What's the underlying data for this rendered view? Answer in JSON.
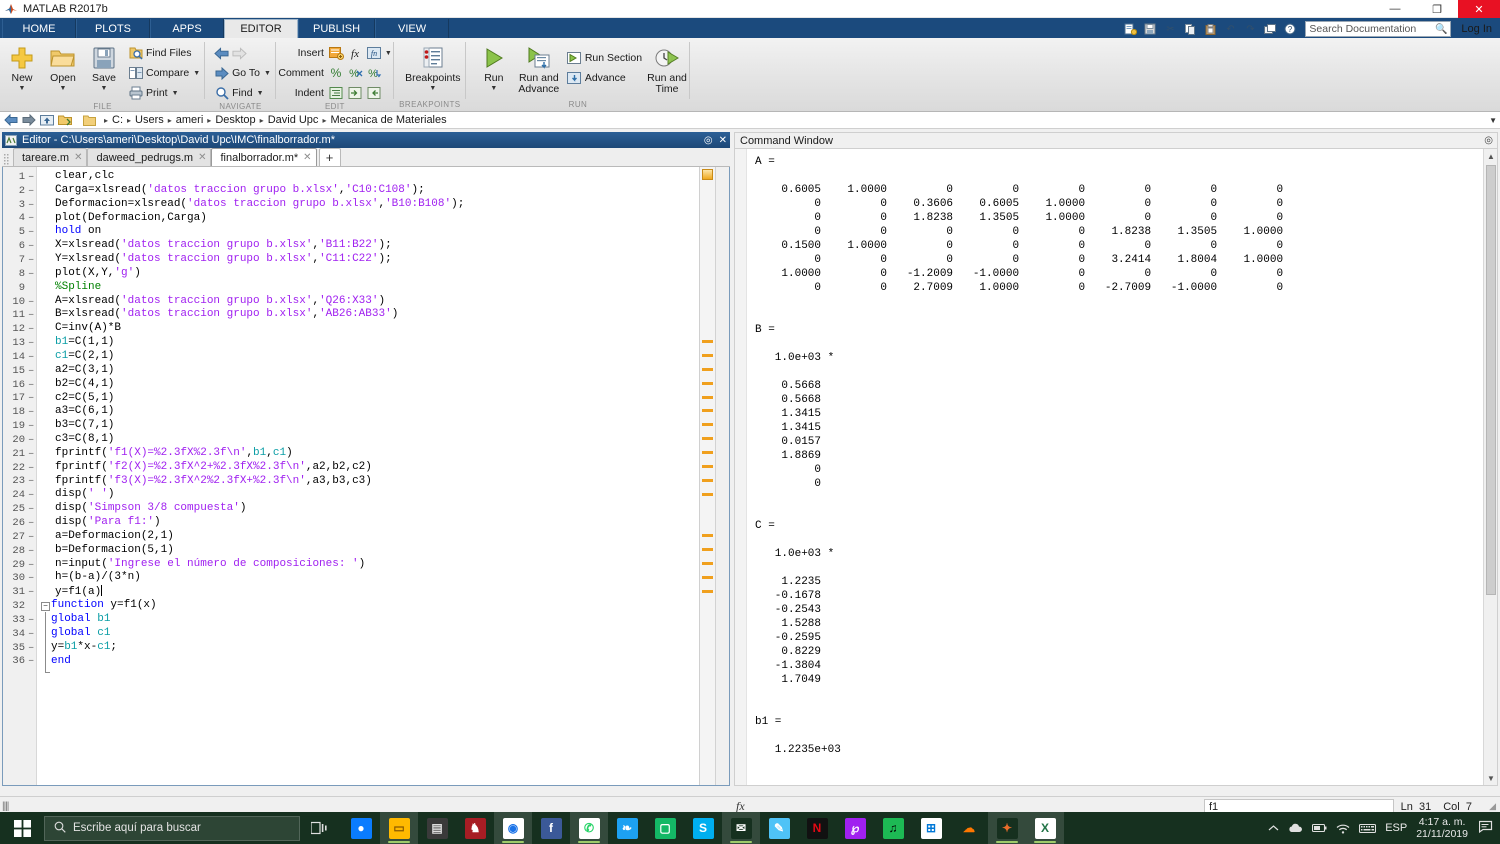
{
  "window": {
    "title": "MATLAB R2017b",
    "minimize": "—",
    "maximize": "❐",
    "close": "✕"
  },
  "ribbon": {
    "tabs": [
      {
        "label": "HOME",
        "active": false
      },
      {
        "label": "PLOTS",
        "active": false
      },
      {
        "label": "APPS",
        "active": false
      },
      {
        "label": "EDITOR",
        "active": true
      },
      {
        "label": "PUBLISH",
        "active": false
      },
      {
        "label": "VIEW",
        "active": false
      }
    ],
    "quick_access": [
      "new-script-icon",
      "save-icon",
      "cut-icon",
      "copy-icon",
      "paste-icon",
      "undo-icon",
      "redo-icon",
      "switch-window-icon",
      "help-icon"
    ],
    "search_placeholder": "Search Documentation",
    "login_label": "Log In",
    "groups": [
      {
        "name": "FILE",
        "label": "FILE",
        "big_buttons": [
          {
            "label": "New",
            "icon": "new-file-icon",
            "has_caret": true
          },
          {
            "label": "Open",
            "icon": "open-folder-icon",
            "has_caret": true
          },
          {
            "label": "Save",
            "icon": "save-disk-icon",
            "has_caret": true
          }
        ],
        "small_buttons": [
          {
            "label": "Find Files",
            "icon": "find-files-icon",
            "has_caret": false
          },
          {
            "label": "Compare",
            "icon": "compare-icon",
            "has_caret": true
          },
          {
            "label": "Print",
            "icon": "print-icon",
            "has_caret": true
          }
        ]
      },
      {
        "name": "NAVIGATE",
        "label": "NAVIGATE",
        "small_buttons": [
          {
            "label": "",
            "icon": "back-arrow-icon",
            "has_caret": false
          },
          {
            "label": "Go To",
            "icon": "go-to-icon",
            "has_caret": true
          },
          {
            "label": "Find",
            "icon": "find-icon",
            "has_caret": true
          }
        ]
      },
      {
        "name": "EDIT",
        "label": "EDIT",
        "rows": [
          {
            "label": "Insert",
            "icons": [
              "insert-block-icon",
              "insert-function-icon",
              "insert-fx-icon"
            ],
            "has_caret": true
          },
          {
            "label": "Comment",
            "icons": [
              "comment-icon",
              "uncomment-icon",
              "wrap-comment-icon"
            ],
            "has_caret": false
          },
          {
            "label": "Indent",
            "icons": [
              "smart-indent-icon",
              "indent-right-icon",
              "indent-left-icon"
            ],
            "has_caret": false
          }
        ]
      },
      {
        "name": "BREAKPOINTS",
        "label": "BREAKPOINTS",
        "big_buttons": [
          {
            "label": "Breakpoints",
            "icon": "breakpoints-icon",
            "has_caret": true
          }
        ]
      },
      {
        "name": "RUN",
        "label": "RUN",
        "big_buttons": [
          {
            "label": "Run",
            "icon": "run-icon",
            "has_caret": true
          },
          {
            "label": "Run and Advance",
            "icon": "run-advance-icon",
            "has_caret": false
          },
          {
            "label": "Run and Time",
            "icon": "run-time-icon",
            "has_caret": false
          }
        ],
        "small_buttons": [
          {
            "label": "Run Section",
            "icon": "run-section-icon",
            "has_caret": false
          },
          {
            "label": "Advance",
            "icon": "advance-icon",
            "has_caret": false
          }
        ]
      }
    ]
  },
  "address_bar": {
    "crumbs": [
      "C:",
      "Users",
      "ameri",
      "Desktop",
      "David Upc",
      "Mecanica de Materiales"
    ],
    "separator": "▸"
  },
  "editor": {
    "title": "Editor - C:\\Users\\ameri\\Desktop\\David Upc\\IMC\\finalborrador.m*",
    "tabs": [
      {
        "label": "tareare.m",
        "active": false
      },
      {
        "label": "daweed_pedrugs.m",
        "active": false
      },
      {
        "label": "finalborrador.m*",
        "active": true
      }
    ],
    "new_tab_label": "+",
    "lines": [
      {
        "n": 1,
        "exec": true,
        "text": "clear,clc"
      },
      {
        "n": 2,
        "exec": true,
        "text": "Carga=xlsread('datos traccion grupo b.xlsx','C10:C108');"
      },
      {
        "n": 3,
        "exec": true,
        "text": "Deformacion=xlsread('datos traccion grupo b.xlsx','B10:B108');"
      },
      {
        "n": 4,
        "exec": true,
        "text": "plot(Deformacion,Carga)"
      },
      {
        "n": 5,
        "exec": true,
        "text": "hold on"
      },
      {
        "n": 6,
        "exec": true,
        "text": "X=xlsread('datos traccion grupo b.xlsx','B11:B22');"
      },
      {
        "n": 7,
        "exec": true,
        "text": "Y=xlsread('datos traccion grupo b.xlsx','C11:C22');"
      },
      {
        "n": 8,
        "exec": true,
        "text": "plot(X,Y,'g')"
      },
      {
        "n": 9,
        "exec": false,
        "text": "%Spline"
      },
      {
        "n": 10,
        "exec": true,
        "text": "A=xlsread('datos traccion grupo b.xlsx','Q26:X33')"
      },
      {
        "n": 11,
        "exec": true,
        "text": "B=xlsread('datos traccion grupo b.xlsx','AB26:AB33')"
      },
      {
        "n": 12,
        "exec": true,
        "text": "C=inv(A)*B"
      },
      {
        "n": 13,
        "exec": true,
        "text": "b1=C(1,1)"
      },
      {
        "n": 14,
        "exec": true,
        "text": "c1=C(2,1)"
      },
      {
        "n": 15,
        "exec": true,
        "text": "a2=C(3,1)"
      },
      {
        "n": 16,
        "exec": true,
        "text": "b2=C(4,1)"
      },
      {
        "n": 17,
        "exec": true,
        "text": "c2=C(5,1)"
      },
      {
        "n": 18,
        "exec": true,
        "text": "a3=C(6,1)"
      },
      {
        "n": 19,
        "exec": true,
        "text": "b3=C(7,1)"
      },
      {
        "n": 20,
        "exec": true,
        "text": "c3=C(8,1)"
      },
      {
        "n": 21,
        "exec": true,
        "text": "fprintf('f1(X)=%2.3fX%2.3f\\n',b1,c1)"
      },
      {
        "n": 22,
        "exec": true,
        "text": "fprintf('f2(X)=%2.3fX^2+%2.3fX%2.3f\\n',a2,b2,c2)"
      },
      {
        "n": 23,
        "exec": true,
        "text": "fprintf('f3(X)=%2.3fX^2%2.3fX+%2.3f\\n',a3,b3,c3)"
      },
      {
        "n": 24,
        "exec": true,
        "text": "disp(' ')"
      },
      {
        "n": 25,
        "exec": true,
        "text": "disp('Simpson 3/8 compuesta')"
      },
      {
        "n": 26,
        "exec": true,
        "text": "disp('Para f1:')"
      },
      {
        "n": 27,
        "exec": true,
        "text": "a=Deformacion(2,1)"
      },
      {
        "n": 28,
        "exec": true,
        "text": "b=Deformacion(5,1)"
      },
      {
        "n": 29,
        "exec": true,
        "text": "n=input('Ingrese el número de composiciones: ')"
      },
      {
        "n": 30,
        "exec": true,
        "text": "h=(b-a)/(3*n)"
      },
      {
        "n": 31,
        "exec": true,
        "text": "y=f1(a)"
      },
      {
        "n": 32,
        "exec": false,
        "text": "function y=f1(x)"
      },
      {
        "n": 33,
        "exec": true,
        "text": "global b1"
      },
      {
        "n": 34,
        "exec": true,
        "text": "global c1"
      },
      {
        "n": 35,
        "exec": true,
        "text": "y=b1*x-c1;"
      },
      {
        "n": 36,
        "exec": true,
        "text": "end"
      }
    ]
  },
  "command_window": {
    "title": "Command Window",
    "output": "A =\n\n    0.6005    1.0000         0         0         0         0         0         0\n         0         0    0.3606    0.6005    1.0000         0         0         0\n         0         0    1.8238    1.3505    1.0000         0         0         0\n         0         0         0         0         0    1.8238    1.3505    1.0000\n    0.1500    1.0000         0         0         0         0         0         0\n         0         0         0         0         0    3.2414    1.8004    1.0000\n    1.0000         0   -1.2009   -1.0000         0         0         0         0\n         0         0    2.7009    1.0000         0   -2.7009   -1.0000         0\n\n\nB =\n\n   1.0e+03 *\n\n    0.5668\n    0.5668\n    1.3415\n    1.3415\n    0.0157\n    1.8869\n         0\n         0\n\n\nC =\n\n   1.0e+03 *\n\n    1.2235\n   -0.1678\n   -0.2543\n    1.5288\n   -0.2595\n    0.8229\n   -1.3804\n    1.7049\n\n\nb1 =\n\n   1.2235e+03\n",
    "prompt_symbol": "fx"
  },
  "status_bar": {
    "function_name": "f1",
    "line_label": "Ln",
    "line_value": "31",
    "col_label": "Col",
    "col_value": "7"
  },
  "taskbar": {
    "search_placeholder": "Escribe aquí para buscar",
    "apps": [
      {
        "name": "messenger",
        "glyph": "●",
        "bg": "#0a7cff",
        "fg": "#ffffff",
        "active": false
      },
      {
        "name": "file-explorer",
        "glyph": "▭",
        "bg": "#ffb900",
        "fg": "#8a5a00",
        "active": true
      },
      {
        "name": "dark-app",
        "glyph": "▤",
        "bg": "#3a3a3a",
        "fg": "#dddddd",
        "active": false
      },
      {
        "name": "red-app",
        "glyph": "♞",
        "bg": "#a71d24",
        "fg": "#ffffff",
        "active": false
      },
      {
        "name": "google-chrome",
        "glyph": "◉",
        "bg": "#ffffff",
        "fg": "#1a73e8",
        "active": true
      },
      {
        "name": "facebook",
        "glyph": "f",
        "bg": "#3b5998",
        "fg": "#ffffff",
        "active": false
      },
      {
        "name": "whatsapp",
        "glyph": "✆",
        "bg": "#ffffff",
        "fg": "#25d366",
        "active": true
      },
      {
        "name": "twitter",
        "glyph": "❧",
        "bg": "#1da1f2",
        "fg": "#ffffff",
        "active": false
      },
      {
        "name": "instagram",
        "glyph": "▢",
        "bg": "#14b866",
        "fg": "#ffffff",
        "active": false
      },
      {
        "name": "skype",
        "glyph": "S",
        "bg": "#00aff0",
        "fg": "#ffffff",
        "active": false
      },
      {
        "name": "mail",
        "glyph": "✉",
        "bg": "#16301f",
        "fg": "#ffffff",
        "active": true
      },
      {
        "name": "paint-3d",
        "glyph": "✎",
        "bg": "#4fc3f7",
        "fg": "#ffffff",
        "active": false
      },
      {
        "name": "netflix",
        "glyph": "N",
        "bg": "#111111",
        "fg": "#e50914",
        "active": false
      },
      {
        "name": "picsart",
        "glyph": "℘",
        "bg": "#a020f0",
        "fg": "#ffffff",
        "active": false
      },
      {
        "name": "spotify",
        "glyph": "♫",
        "bg": "#1db954",
        "fg": "#000000",
        "active": false
      },
      {
        "name": "microsoft-store",
        "glyph": "⊞",
        "bg": "#ffffff",
        "fg": "#0078d7",
        "active": false
      },
      {
        "name": "soundcloud",
        "glyph": "☁",
        "bg": "#16301f",
        "fg": "#ff7700",
        "active": false
      },
      {
        "name": "matlab",
        "glyph": "✦",
        "bg": "#16301f",
        "fg": "#e86c2a",
        "active": true
      },
      {
        "name": "excel",
        "glyph": "X",
        "bg": "#ffffff",
        "fg": "#217346",
        "active": true
      }
    ],
    "tray": [
      "chevron-up-icon",
      "cloud-icon",
      "battery-icon",
      "wifi-icon",
      "keyboard-icon"
    ],
    "language": "ESP",
    "time": "4:17 a. m.",
    "date": "21/11/2019",
    "notification": "notification-icon"
  },
  "colors": {
    "ribbon_blue": "#1b4a7d",
    "accent_orange": "#f0a01e",
    "string_purple": "#a020f0",
    "comment_green": "#008000",
    "keyword_blue": "#0000ff"
  }
}
